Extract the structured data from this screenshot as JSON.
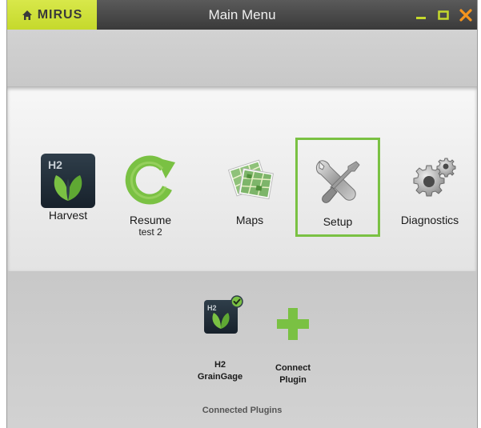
{
  "window": {
    "brand": "MIRUS",
    "title": "Main Menu",
    "minimize_icon": "minimize-icon",
    "maximize_icon": "maximize-icon",
    "close_icon": "close-icon"
  },
  "menu": {
    "items": [
      {
        "label": "Harvest",
        "icon": "h2-harvest-icon"
      },
      {
        "label": "Resume",
        "sublabel": "test 2",
        "icon": "refresh-arrow-icon"
      },
      {
        "label": "Maps",
        "icon": "maps-icon"
      },
      {
        "label": "Setup",
        "icon": "wrench-screwdriver-icon",
        "selected": true
      },
      {
        "label": "Diagnostics",
        "icon": "gears-icon"
      }
    ]
  },
  "plugins": {
    "items": [
      {
        "line1": "H2",
        "line2": "GrainGage",
        "icon": "h2-graingage-icon",
        "status": "connected"
      },
      {
        "line1": "Connect",
        "line2": "Plugin",
        "icon": "plus-icon"
      }
    ],
    "section_label": "Connected Plugins"
  },
  "colors": {
    "brand_yellow": "#c5d92c",
    "accent_green": "#7ac143",
    "close_orange": "#f7941d"
  }
}
